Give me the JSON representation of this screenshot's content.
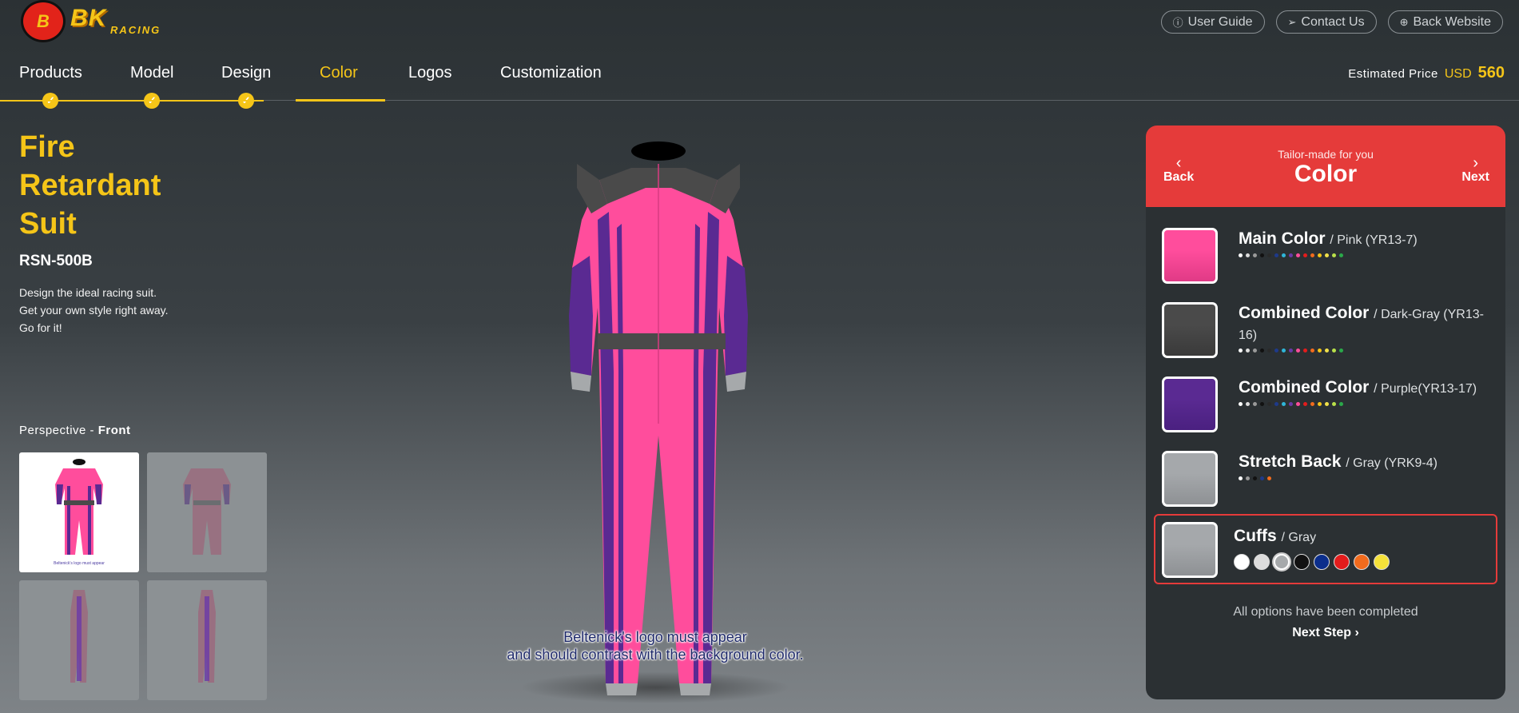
{
  "header": {
    "logo_text": "BK",
    "logo_sub": "RACING",
    "links": [
      {
        "label": "User Guide",
        "icon": "info-icon"
      },
      {
        "label": "Contact Us",
        "icon": "send-icon"
      },
      {
        "label": "Back Website",
        "icon": "globe-icon"
      }
    ]
  },
  "nav": {
    "items": [
      {
        "label": "Products",
        "completed": true
      },
      {
        "label": "Model",
        "completed": true
      },
      {
        "label": "Design",
        "completed": true
      },
      {
        "label": "Color",
        "completed": false,
        "active": true
      },
      {
        "label": "Logos",
        "completed": false
      },
      {
        "label": "Customization",
        "completed": false
      }
    ],
    "price_label": "Estimated Price",
    "price_currency": "USD",
    "price_value": "560"
  },
  "product": {
    "title_line1": "Fire",
    "title_line2": "Retardant",
    "title_line3": "Suit",
    "model": "RSN-500B",
    "desc_line1": "Design the ideal racing suit.",
    "desc_line2": "Get your own style right away.",
    "desc_line3": "Go for it!",
    "perspective_label": "Perspective -",
    "perspective_value": "Front"
  },
  "suit": {
    "warning_line1": "Beltenick's logo must appear",
    "warning_line2": "and should contrast with the background color.",
    "colors": {
      "main": "#ff4d9c",
      "combined": "#4a4a4a",
      "accent": "#5a2a92",
      "stretch": "#9a9da0",
      "cuffs": "#a6a9ab"
    }
  },
  "panel": {
    "subtitle": "Tailor-made for you",
    "title": "Color",
    "back_label": "Back",
    "next_label": "Next",
    "options": [
      {
        "name": "Main Color",
        "value": "/ Pink (YR13-7)",
        "swatch": "#ff4d9c"
      },
      {
        "name": "Combined Color",
        "value": "/ Dark-Gray (YR13-16)",
        "swatch": "#4a4a4a"
      },
      {
        "name": "Combined Color",
        "value": "/ Purple(YR13-17)",
        "swatch": "#5a2a92"
      },
      {
        "name": "Stretch Back",
        "value": "/ Gray (YRK9-4)",
        "swatch": "#a5a8ab"
      },
      {
        "name": "Cuffs",
        "value": "/ Gray",
        "swatch": "#a5a8ab"
      }
    ],
    "palette_colors": [
      "#ffffff",
      "#dcdcdc",
      "#9a9a9a",
      "#111111",
      "#2a2a2a",
      "#1e3a8a",
      "#2fb5d8",
      "#6a3aa8",
      "#ff4d9c",
      "#e31c1c",
      "#f26b1d",
      "#f5c518",
      "#f0e04a",
      "#b9e04a",
      "#2aa84a"
    ],
    "stretch_colors": [
      "#ffffff",
      "#9a9a9a",
      "#111111",
      "#1e3a8a",
      "#f26b1d"
    ],
    "cuff_colors": [
      "#ffffff",
      "#dcdcdc",
      "#a6a9ab",
      "#111111",
      "#0b2e8c",
      "#e31c1c",
      "#f26b1d",
      "#f5e13a"
    ],
    "completed_text": "All options have been completed",
    "next_step_label": "Next Step"
  }
}
